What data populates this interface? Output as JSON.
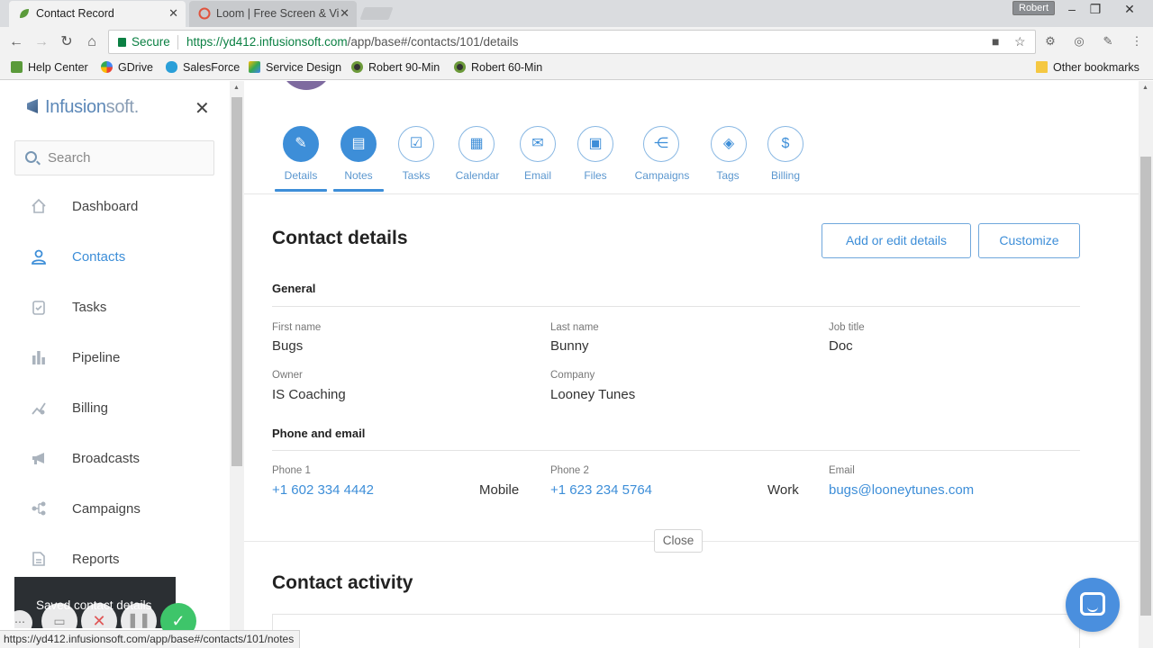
{
  "browser": {
    "tabs": [
      {
        "title": "Contact Record",
        "active": true
      },
      {
        "title": "Loom | Free Screen & Vi",
        "active": false
      }
    ],
    "profile": "Robert",
    "secure_label": "Secure",
    "url_host": "https://yd412.infusionsoft.com",
    "url_path": "/app/base#/contacts/101/details",
    "bookmarks": [
      "Help Center",
      "GDrive",
      "SalesForce",
      "Service Design",
      "Robert 90-Min",
      "Robert 60-Min"
    ],
    "other_bookmarks": "Other bookmarks",
    "status_url": "https://yd412.infusionsoft.com/app/base#/contacts/101/notes"
  },
  "sidebar": {
    "logo_infusion": "Infusion",
    "logo_soft": "soft.",
    "search_placeholder": "Search",
    "items": [
      {
        "label": "Dashboard",
        "icon": "home-icon",
        "active": false
      },
      {
        "label": "Contacts",
        "icon": "person-icon",
        "active": true
      },
      {
        "label": "Tasks",
        "icon": "clipboard-icon",
        "active": false
      },
      {
        "label": "Pipeline",
        "icon": "bar-chart-icon",
        "active": false
      },
      {
        "label": "Billing",
        "icon": "billing-icon",
        "active": false
      },
      {
        "label": "Broadcasts",
        "icon": "megaphone-icon",
        "active": false
      },
      {
        "label": "Campaigns",
        "icon": "campaign-icon",
        "active": false
      },
      {
        "label": "Reports",
        "icon": "report-icon",
        "active": false
      }
    ]
  },
  "toast": {
    "text": "Saved contact details"
  },
  "contact_tabs": [
    {
      "label": "Details",
      "icon": "person-edit-icon",
      "selected": true
    },
    {
      "label": "Notes",
      "icon": "notes-icon",
      "selected": true
    },
    {
      "label": "Tasks",
      "icon": "clipboard-check-icon",
      "selected": false
    },
    {
      "label": "Calendar",
      "icon": "calendar-icon",
      "selected": false
    },
    {
      "label": "Email",
      "icon": "mail-icon",
      "selected": false
    },
    {
      "label": "Files",
      "icon": "save-icon",
      "selected": false
    },
    {
      "label": "Campaigns",
      "icon": "campaign-icon",
      "selected": false
    },
    {
      "label": "Tags",
      "icon": "tag-icon",
      "selected": false
    },
    {
      "label": "Billing",
      "icon": "dollar-icon",
      "selected": false
    }
  ],
  "details": {
    "title": "Contact details",
    "add_edit_label": "Add or edit details",
    "customize_label": "Customize",
    "general_title": "General",
    "first_name_label": "First name",
    "first_name": "Bugs",
    "last_name_label": "Last name",
    "last_name": "Bunny",
    "job_title_label": "Job title",
    "job_title": "Doc",
    "owner_label": "Owner",
    "owner": "IS Coaching",
    "company_label": "Company",
    "company": "Looney Tunes",
    "phone_email_title": "Phone and email",
    "phone1_label": "Phone 1",
    "phone1": "+1 602 334 4442",
    "phone1_type": "Mobile",
    "phone2_label": "Phone 2",
    "phone2": "+1 623 234 5764",
    "phone2_type": "Work",
    "email_label": "Email",
    "email": "bugs@looneytunes.com",
    "close_label": "Close"
  },
  "activity": {
    "title": "Contact activity"
  },
  "colors": {
    "accent": "#3d8ed8",
    "toast_bg": "#2b2f33",
    "chat_bubble": "#4a8fde"
  }
}
